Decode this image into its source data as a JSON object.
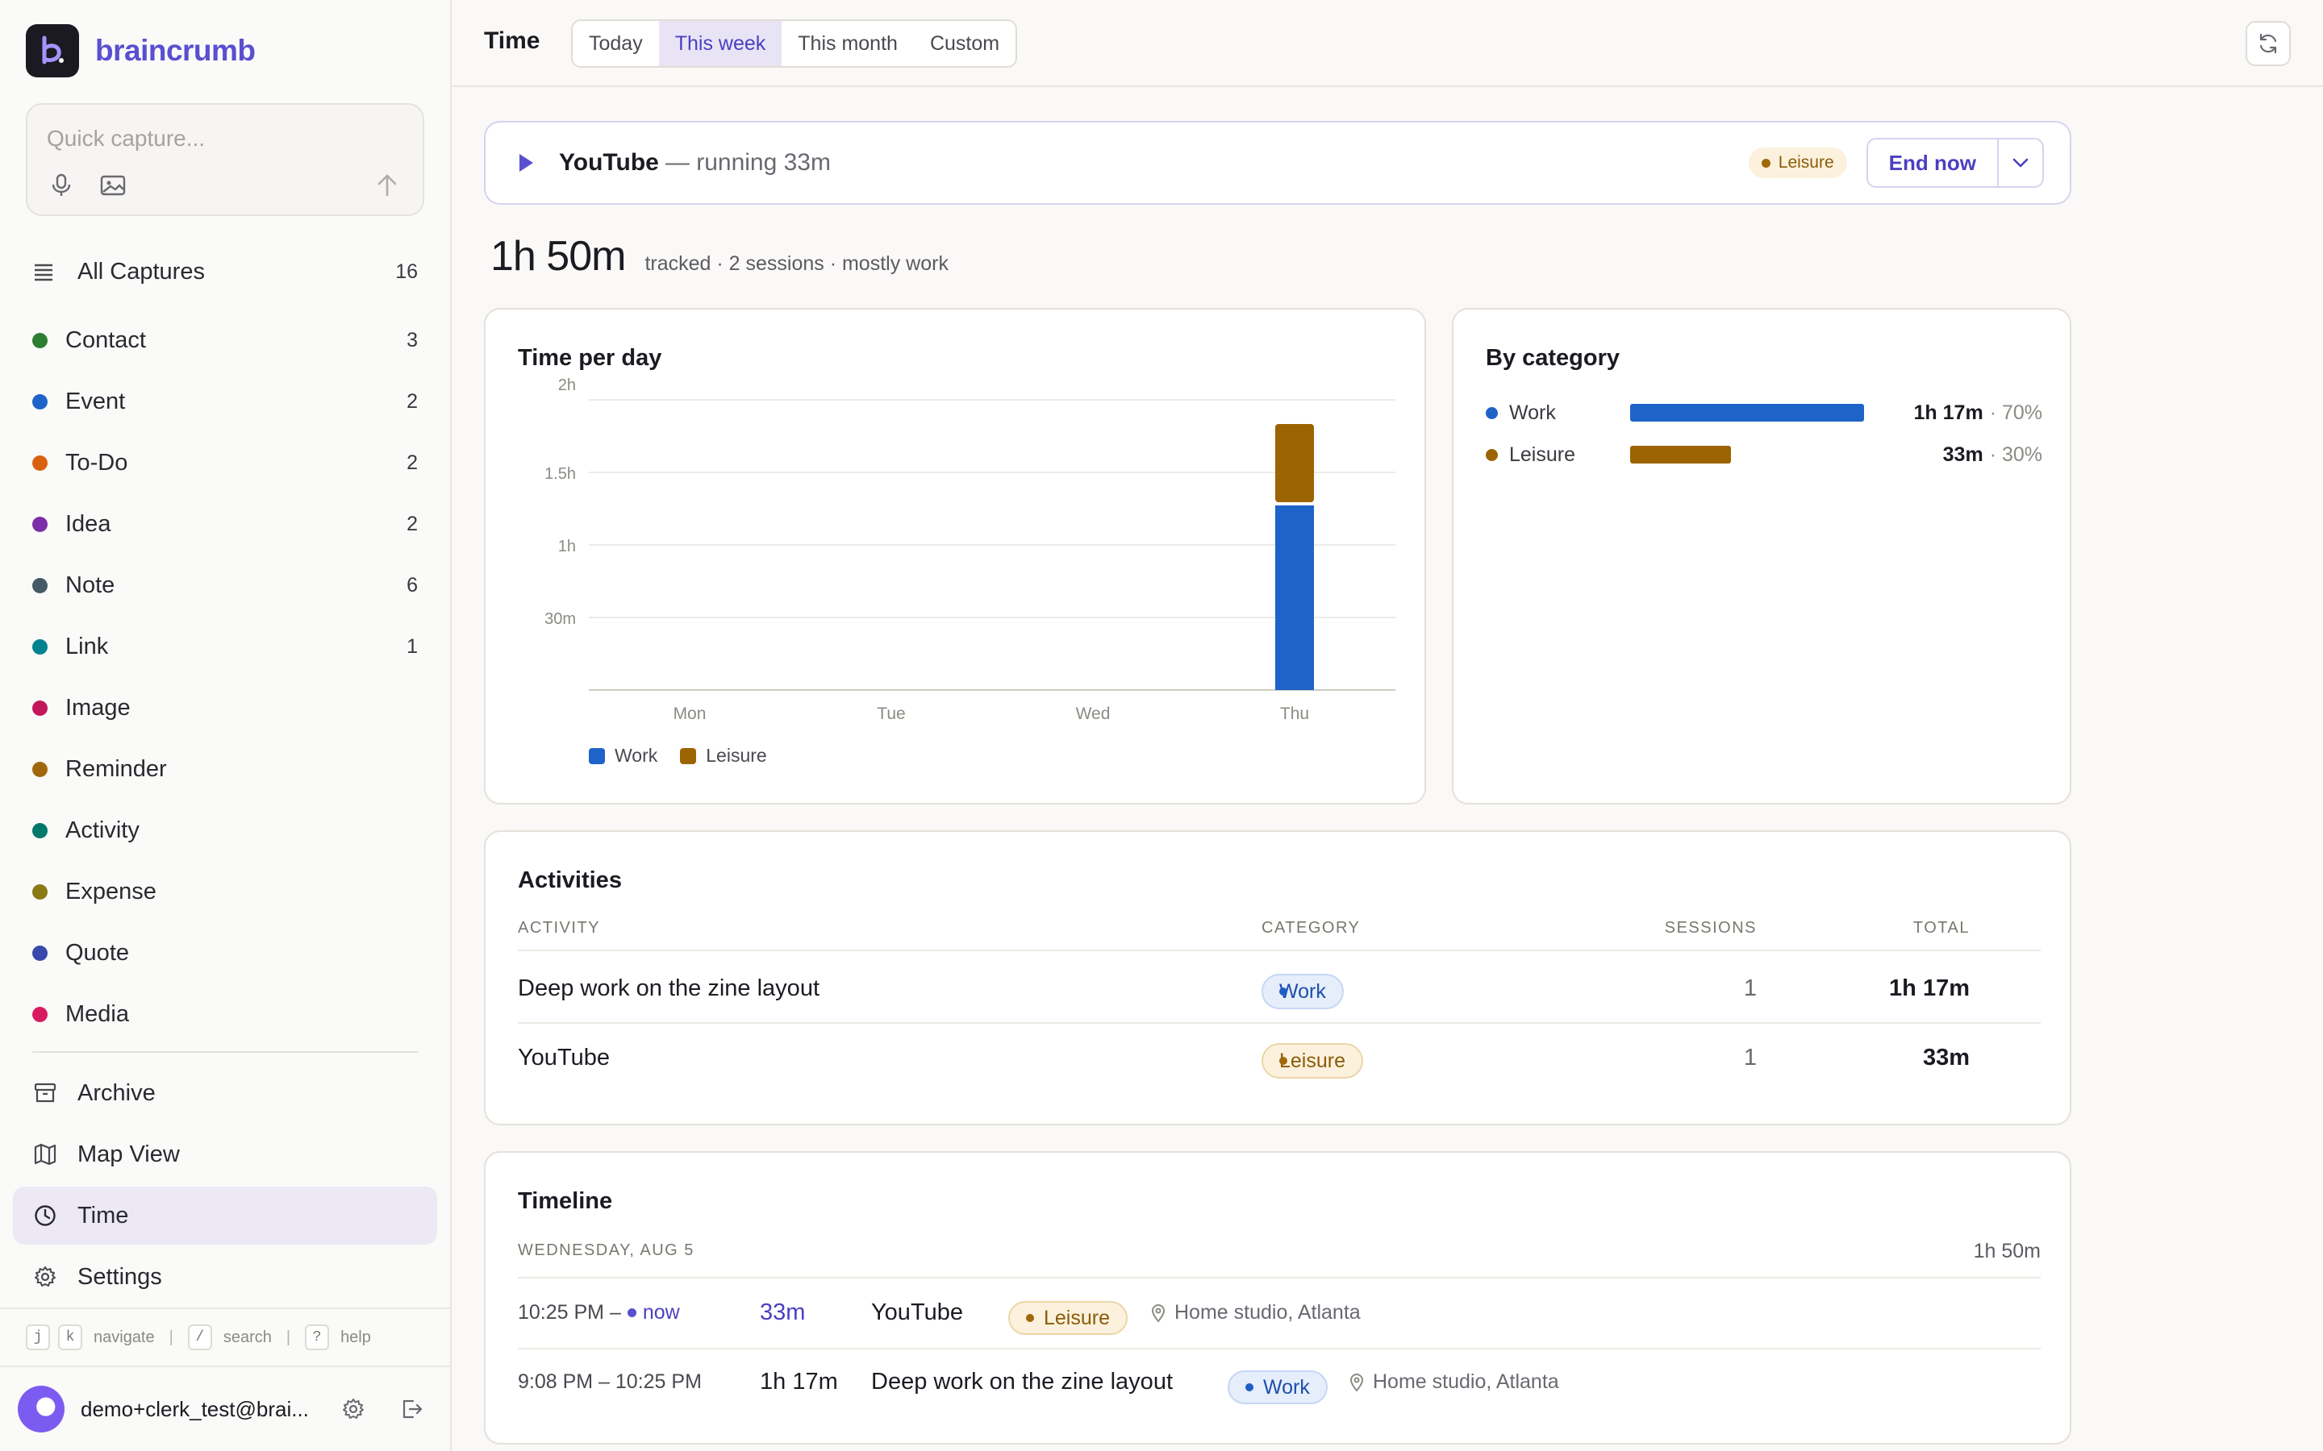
{
  "app": {
    "name": "braincrumb"
  },
  "capture": {
    "placeholder": "Quick capture..."
  },
  "sidebar": {
    "all_captures": {
      "label": "All Captures",
      "count": "16"
    },
    "categories": [
      {
        "label": "Contact",
        "count": "3",
        "color": "#2e7d32"
      },
      {
        "label": "Event",
        "count": "2",
        "color": "#1e63c8"
      },
      {
        "label": "To-Do",
        "count": "2",
        "color": "#d9600f"
      },
      {
        "label": "Idea",
        "count": "2",
        "color": "#7b2fa8"
      },
      {
        "label": "Note",
        "count": "6",
        "color": "#455a64"
      },
      {
        "label": "Link",
        "count": "1",
        "color": "#00838f"
      },
      {
        "label": "Image",
        "count": "",
        "color": "#c2185b"
      },
      {
        "label": "Reminder",
        "count": "",
        "color": "#a0680a"
      },
      {
        "label": "Activity",
        "count": "",
        "color": "#00796b"
      },
      {
        "label": "Expense",
        "count": "",
        "color": "#8a7a13"
      },
      {
        "label": "Quote",
        "count": "",
        "color": "#3949ab"
      },
      {
        "label": "Media",
        "count": "",
        "color": "#d81b60"
      }
    ],
    "nav": [
      {
        "label": "Archive",
        "icon": "archive-icon"
      },
      {
        "label": "Map View",
        "icon": "map-icon"
      },
      {
        "label": "Time",
        "icon": "clock-icon",
        "active": true
      },
      {
        "label": "Settings",
        "icon": "gear-icon"
      }
    ],
    "shortcuts": {
      "j": "j",
      "k": "k",
      "navigate": "navigate",
      "slash": "/",
      "search": "search",
      "q": "?",
      "help": "help"
    },
    "user": {
      "email": "demo+clerk_test@brai..."
    }
  },
  "header": {
    "title": "Time",
    "ranges": [
      "Today",
      "This week",
      "This month",
      "Custom"
    ],
    "active_range": "This week"
  },
  "running": {
    "activity": "YouTube",
    "status": "— running 33m",
    "category": "Leisure",
    "end_label": "End now"
  },
  "summary": {
    "total": "1h 50m",
    "detail": "tracked · 2 sessions · mostly work"
  },
  "time_per_day": {
    "title": "Time per day",
    "legend": [
      {
        "name": "Work",
        "color": "#1e63c8"
      },
      {
        "name": "Leisure",
        "color": "#9c6400"
      }
    ]
  },
  "chart_data": {
    "type": "bar",
    "title": "Time per day",
    "stacked": true,
    "categories": [
      "Mon",
      "Tue",
      "Wed",
      "Thu"
    ],
    "y_ticks": [
      "30m",
      "1h",
      "1.5h",
      "2h"
    ],
    "ylim_minutes": [
      0,
      120
    ],
    "series": [
      {
        "name": "Work",
        "color": "#1e63c8",
        "values": [
          0,
          0,
          0,
          77
        ]
      },
      {
        "name": "Leisure",
        "color": "#9c6400",
        "values": [
          0,
          0,
          0,
          33
        ]
      }
    ],
    "grid": true,
    "legend": "bottom-left"
  },
  "by_category": {
    "title": "By category",
    "rows": [
      {
        "name": "Work",
        "value": "1h 17m",
        "pct": "· 70%",
        "fraction": 1.0,
        "color": "#1e63c8"
      },
      {
        "name": "Leisure",
        "value": "33m",
        "pct": "· 30%",
        "fraction": 0.43,
        "color": "#9c6400"
      }
    ]
  },
  "activities": {
    "title": "Activities",
    "headers": {
      "activity": "ACTIVITY",
      "category": "CATEGORY",
      "sessions": "SESSIONS",
      "total": "TOTAL"
    },
    "rows": [
      {
        "activity": "Deep work on the zine layout",
        "category": "Work",
        "sessions": "1",
        "total": "1h 17m"
      },
      {
        "activity": "YouTube",
        "category": "Leisure",
        "sessions": "1",
        "total": "33m"
      }
    ]
  },
  "timeline": {
    "title": "Timeline",
    "day": "WEDNESDAY, AUG 5",
    "day_total": "1h 50m",
    "entries": [
      {
        "time": "10:25 PM –",
        "now": "now",
        "duration": "33m",
        "name": "YouTube",
        "category": "Leisure",
        "location": "Home studio, Atlanta"
      },
      {
        "time": "9:08 PM – 10:25 PM",
        "now": "",
        "duration": "1h 17m",
        "name": "Deep work on the zine layout",
        "category": "Work",
        "location": "Home studio, Atlanta"
      }
    ]
  }
}
